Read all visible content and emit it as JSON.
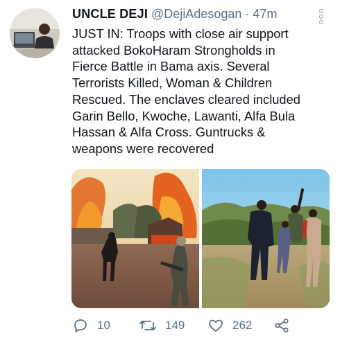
{
  "author": {
    "display_name": "UNCLE DEJI",
    "handle": "@DejiAdesogan",
    "separator": "·",
    "time": "47m"
  },
  "tweet_lines": [
    "JUST IN: Troops with close air support",
    "attacked BokoHaram Strongholds in",
    "Fierce Battle in Bama axis. Several",
    "Terrorists Killed, Woman & Children",
    "Rescued. The enclaves cleared included",
    "Garin Bello, Kwoche, Lawanti, Alfa Bula",
    "Hassan & Alfa Cross. Guntrucks &",
    "weapons were recovered"
  ],
  "media": {
    "photo_1_icon": "fire-scene-photo",
    "photo_2_icon": "rescued-group-photo"
  },
  "actions": {
    "reply_count": "10",
    "retweet_count": "149",
    "like_count": "262",
    "reply_icon": "comment-icon",
    "retweet_icon": "retweet-icon",
    "like_icon": "heart-icon",
    "share_icon": "share-icon"
  },
  "colors": {
    "text": "#0f1419",
    "secondary": "#5b7083"
  }
}
